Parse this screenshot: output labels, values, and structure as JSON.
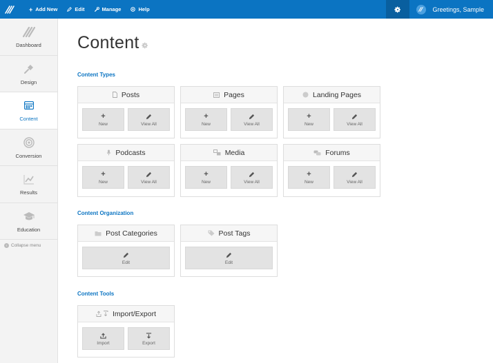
{
  "topbar": {
    "add_new": "Add New",
    "edit": "Edit",
    "manage": "Manage",
    "help": "Help",
    "greeting": "Greetings, Sample",
    "bar_color": "#0b74c2"
  },
  "sidebar": {
    "items": [
      {
        "label": "Dashboard",
        "icon": "stripes-icon"
      },
      {
        "label": "Design",
        "icon": "pin-icon"
      },
      {
        "label": "Content",
        "icon": "grid-icon",
        "active": true
      },
      {
        "label": "Conversion",
        "icon": "target-icon"
      },
      {
        "label": "Results",
        "icon": "chart-icon"
      },
      {
        "label": "Education",
        "icon": "graduation-cap-icon"
      }
    ],
    "collapse": "Collapse menu"
  },
  "page": {
    "title": "Content"
  },
  "sections": {
    "types": "Content Types",
    "organization": "Content Organization",
    "tools": "Content Tools"
  },
  "cards": {
    "posts": {
      "title": "Posts",
      "new": "New",
      "view": "View All"
    },
    "pages": {
      "title": "Pages",
      "new": "New",
      "view": "View All"
    },
    "landing": {
      "title": "Landing Pages",
      "new": "New",
      "view": "View All"
    },
    "podcasts": {
      "title": "Podcasts",
      "new": "New",
      "view": "View All"
    },
    "media": {
      "title": "Media",
      "new": "New",
      "view": "View All"
    },
    "forums": {
      "title": "Forums",
      "new": "New",
      "view": "View All"
    },
    "categories": {
      "title": "Post Categories",
      "edit": "Edit"
    },
    "tags": {
      "title": "Post Tags",
      "edit": "Edit"
    },
    "import_export": {
      "title": "Import/Export",
      "import": "Import",
      "export": "Export"
    }
  }
}
